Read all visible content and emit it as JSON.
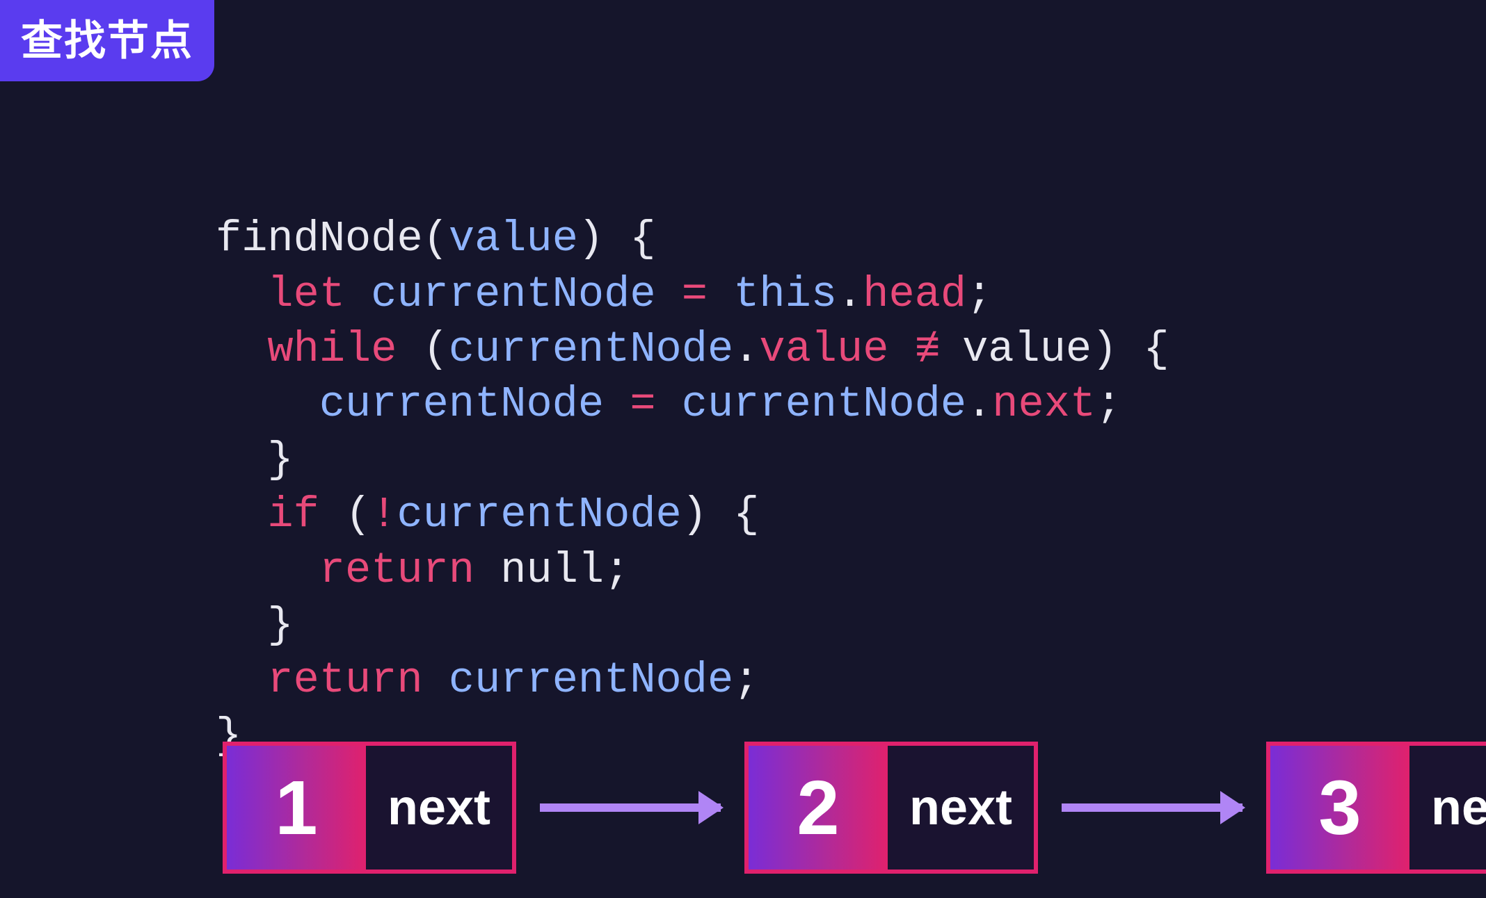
{
  "header": {
    "title": "查找节点"
  },
  "code": {
    "l1": {
      "fn": "findNode",
      "open": "(",
      "param": "value",
      "closeBrace": ") {"
    },
    "l2": {
      "let": "let",
      "sp1": " ",
      "var": "currentNode",
      "sp2": " ",
      "eq": "=",
      "sp3": " ",
      "this": "this",
      "dot": ".",
      "head": "head",
      "semi": ";"
    },
    "l3": {
      "while": "while",
      "sp1": " ",
      "open": "(",
      "var": "currentNode",
      "dot": ".",
      "prop": "value",
      "sp2": " ",
      "neq": "≠≡",
      "sp3": " ",
      "val": "value",
      "close": ")",
      "sp4": " ",
      "brace": "{"
    },
    "l4": {
      "var1": "currentNode",
      "sp1": " ",
      "eq": "=",
      "sp2": " ",
      "var2": "currentNode",
      "dot": ".",
      "prop": "next",
      "semi": ";"
    },
    "l5": {
      "brace": "}"
    },
    "l6": {
      "if": "if",
      "sp1": " ",
      "open": "(",
      "bang": "!",
      "var": "currentNode",
      "close": ")",
      "sp2": " ",
      "brace": "{"
    },
    "l7": {
      "ret": "return",
      "sp": " ",
      "null": "null",
      "semi": ";"
    },
    "l8": {
      "brace": "}"
    },
    "l9": {
      "ret": "return",
      "sp": " ",
      "var": "currentNode",
      "semi": ";"
    },
    "l10": {
      "brace": "}"
    }
  },
  "nodes": {
    "n1": {
      "value": "1",
      "label": "next"
    },
    "n2": {
      "value": "2",
      "label": "next"
    },
    "n3": {
      "value": "3",
      "label": "next"
    }
  }
}
